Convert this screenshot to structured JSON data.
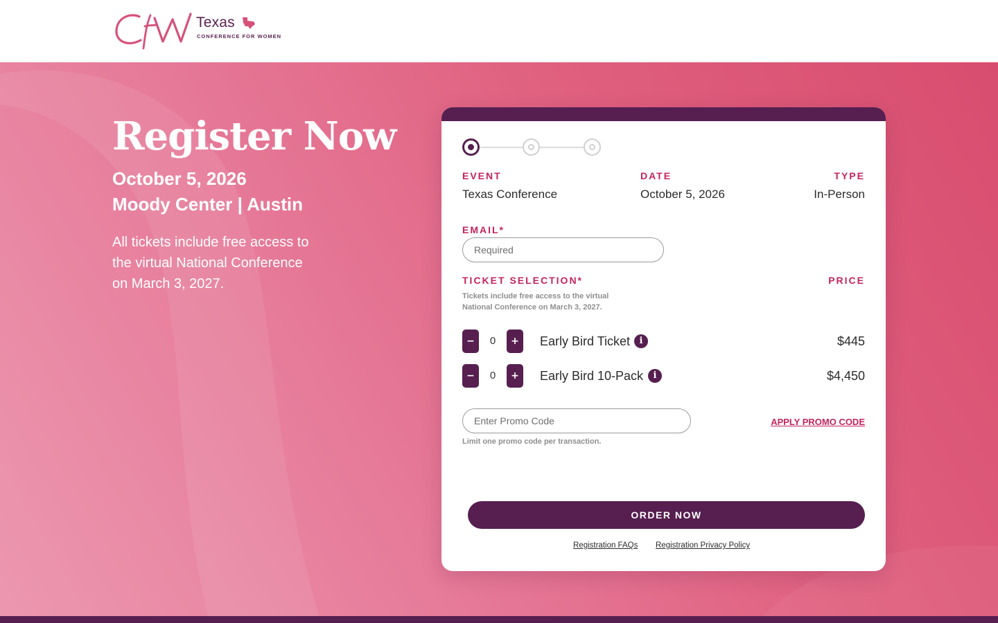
{
  "header": {
    "logo_text": "Texas",
    "logo_subtitle": "CONFERENCE FOR WOMEN",
    "logo_monogram": "CfW"
  },
  "hero": {
    "title": "Register Now",
    "date": "October 5, 2026",
    "venue": "Moody Center | Austin",
    "note": "All tickets include free access to the virtual National Conference on March 3, 2027."
  },
  "form": {
    "steps": [
      {
        "state": "active"
      },
      {
        "state": "inactive"
      },
      {
        "state": "inactive"
      }
    ],
    "event_label": "EVENT",
    "event_value": "Texas Conference",
    "date_label": "DATE",
    "date_value": "October 5, 2026",
    "type_label": "TYPE",
    "type_value": "In-Person",
    "email_label": "EMAIL*",
    "email_placeholder": "Required",
    "ticket_label": "TICKET SELECTION*",
    "price_label": "PRICE",
    "ticket_hint": "Tickets include free access to the virtual National Conference on March 3, 2027.",
    "tickets": [
      {
        "name": "Early Bird Ticket",
        "qty": "0",
        "price": "$445"
      },
      {
        "name": "Early Bird 10-Pack",
        "qty": "0",
        "price": "$4,450"
      }
    ],
    "minus_label": "−",
    "plus_label": "+",
    "info_label": "i",
    "promo_placeholder": "Enter Promo Code",
    "promo_hint": "Limit one promo code per transaction.",
    "apply_label": "APPLY PROMO CODE",
    "order_label": "ORDER NOW",
    "faq_link": "Registration FAQs",
    "privacy_link": "Registration Privacy Policy"
  },
  "colors": {
    "accent": "#561f50",
    "label": "#c4245c",
    "hero": "#e0607f"
  }
}
